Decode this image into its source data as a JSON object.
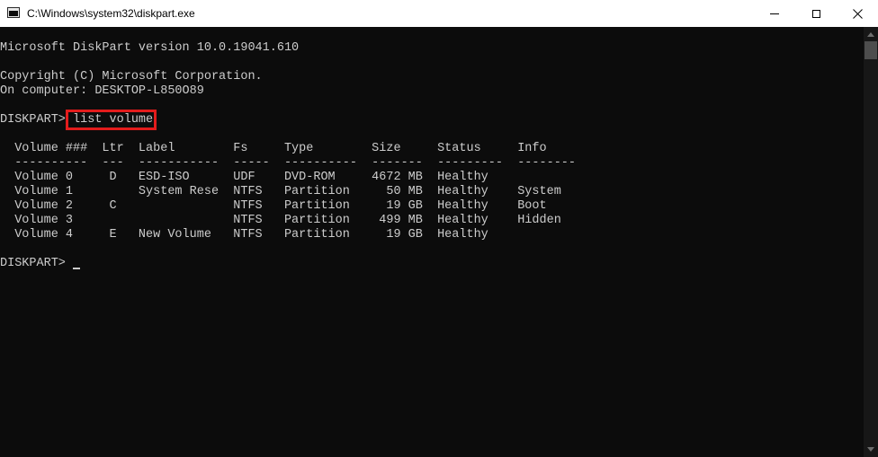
{
  "window": {
    "title": "C:\\Windows\\system32\\diskpart.exe",
    "icon": "console-app-icon"
  },
  "console": {
    "header": [
      "Microsoft DiskPart version 10.0.19041.610",
      "",
      "Copyright (C) Microsoft Corporation.",
      "On computer: DESKTOP-L850O89"
    ],
    "prompt": "DISKPART> ",
    "command": "list volume",
    "table_header": "  Volume ###  Ltr  Label        Fs     Type        Size     Status     Info",
    "table_rule": "  ----------  ---  -----------  -----  ----------  -------  ---------  --------",
    "volumes": [
      "  Volume 0     D   ESD-ISO      UDF    DVD-ROM     4672 MB  Healthy",
      "  Volume 1         System Rese  NTFS   Partition     50 MB  Healthy    System",
      "  Volume 2     C                NTFS   Partition     19 GB  Healthy    Boot",
      "  Volume 3                      NTFS   Partition    499 MB  Healthy    Hidden",
      "  Volume 4     E   New Volume   NTFS   Partition     19 GB  Healthy"
    ],
    "final_prompt": "DISKPART> ",
    "highlight_color": "#e21c1c"
  }
}
